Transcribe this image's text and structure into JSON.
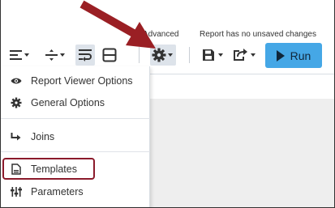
{
  "status": {
    "mode": "Advanced",
    "save_state": "Report has no unsaved changes"
  },
  "toolbar": {
    "buttons": [
      {
        "name": "align",
        "icon": "align-lines-icon"
      },
      {
        "name": "spacing",
        "icon": "line-spacing-icon"
      },
      {
        "name": "wrap",
        "icon": "text-wrap-icon"
      },
      {
        "name": "split",
        "icon": "split-view-icon"
      },
      {
        "name": "settings",
        "icon": "gear-icon"
      },
      {
        "name": "save",
        "icon": "floppy-disk-icon"
      },
      {
        "name": "share",
        "icon": "share-icon"
      }
    ],
    "run_label": "Run"
  },
  "menu": {
    "items": [
      {
        "label": "Report Viewer Options",
        "icon": "eye-icon"
      },
      {
        "label": "General Options",
        "icon": "gear-icon"
      },
      {
        "label": "Joins",
        "icon": "join-arrow-icon"
      },
      {
        "label": "Templates",
        "icon": "document-icon"
      },
      {
        "label": "Parameters",
        "icon": "sliders-icon"
      }
    ]
  },
  "colors": {
    "run_button": "#45a7e6",
    "highlight_box": "#8b1a2b",
    "annotation_arrow": "#9a1f24",
    "active_button_bg": "#dde3ea"
  }
}
